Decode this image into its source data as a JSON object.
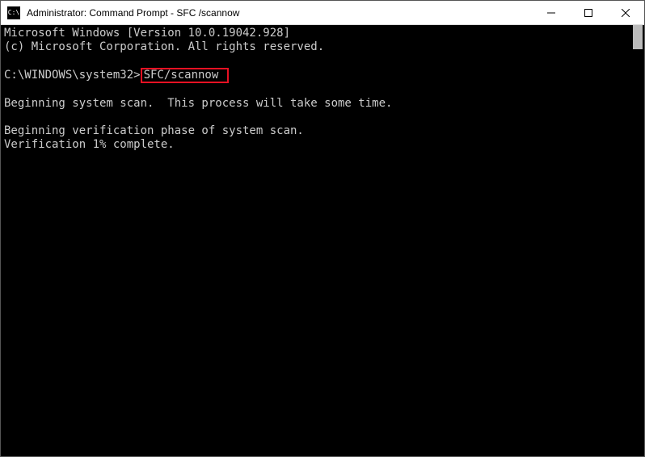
{
  "titlebar": {
    "title": "Administrator: Command Prompt - SFC /scannow"
  },
  "terminal": {
    "line1": "Microsoft Windows [Version 10.0.19042.928]",
    "line2": "(c) Microsoft Corporation. All rights reserved.",
    "blank1": "",
    "prompt_prefix": "C:\\WINDOWS\\system32>",
    "command_highlight": "SFC/scannow ",
    "blank2": "",
    "line3": "Beginning system scan.  This process will take some time.",
    "blank3": "",
    "line4": "Beginning verification phase of system scan.",
    "line5": "Verification 1% complete."
  }
}
